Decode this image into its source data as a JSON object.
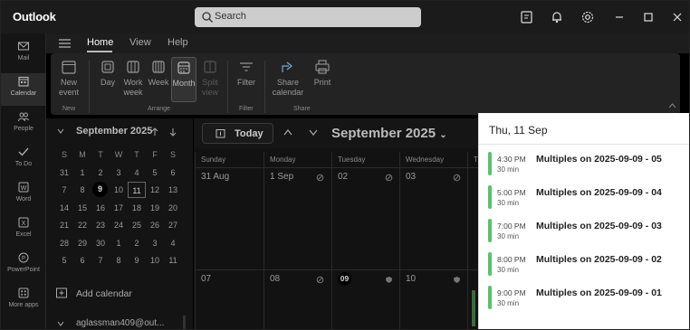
{
  "titlebar": {
    "app_title": "Outlook",
    "search_placeholder": "Search"
  },
  "rail": [
    {
      "label": "Mail",
      "icon": "mail-icon"
    },
    {
      "label": "Calendar",
      "icon": "calendar-icon"
    },
    {
      "label": "People",
      "icon": "people-icon"
    },
    {
      "label": "To Do",
      "icon": "todo-icon"
    },
    {
      "label": "Word",
      "icon": "word-icon"
    },
    {
      "label": "Excel",
      "icon": "excel-icon"
    },
    {
      "label": "PowerPoint",
      "icon": "powerpoint-icon"
    },
    {
      "label": "More apps",
      "icon": "more-apps-icon"
    }
  ],
  "ribbon": {
    "tabs": [
      "Home",
      "View",
      "Help"
    ],
    "new_event": "New event",
    "new_group": "New",
    "views": [
      "Day",
      "Work week",
      "Week",
      "Month",
      "Split view"
    ],
    "arrange_group": "Arrange",
    "filter": "Filter",
    "filter_group": "Filter",
    "share_calendar": "Share calendar",
    "print": "Print",
    "share_group": "Share"
  },
  "mini_calendar": {
    "month": "September 2025",
    "weekdays": [
      "S",
      "M",
      "T",
      "W",
      "T",
      "F",
      "S"
    ],
    "weeks": [
      [
        "31",
        "1",
        "2",
        "3",
        "4",
        "5",
        "6"
      ],
      [
        "7",
        "8",
        "9",
        "10",
        "11",
        "12",
        "13"
      ],
      [
        "14",
        "15",
        "16",
        "17",
        "18",
        "19",
        "20"
      ],
      [
        "21",
        "22",
        "23",
        "24",
        "25",
        "26",
        "27"
      ],
      [
        "28",
        "29",
        "30",
        "1",
        "2",
        "3",
        "4"
      ],
      [
        "5",
        "6",
        "7",
        "8",
        "9",
        "10",
        "11"
      ]
    ],
    "today": "9",
    "selected": "11"
  },
  "side": {
    "add_calendar": "Add calendar",
    "account": "aglassman409@out..."
  },
  "calendar": {
    "today_button": "Today",
    "title": "September 2025",
    "day_headers": [
      "Sunday",
      "Monday",
      "Tuesday",
      "Wednesday",
      "T"
    ],
    "week1": [
      "31 Aug",
      "1 Sep",
      "02",
      "03",
      ""
    ],
    "week2": [
      "07",
      "08",
      "09",
      "10",
      ""
    ]
  },
  "panel": {
    "date": "Thu, 11 Sep",
    "events": [
      {
        "time": "4:30 PM",
        "duration": "30 min",
        "title": "Multiples on 2025-09-09 - 05"
      },
      {
        "time": "5:00 PM",
        "duration": "30 min",
        "title": "Multiples on 2025-09-09 - 04"
      },
      {
        "time": "7:00 PM",
        "duration": "30 min",
        "title": "Multiples on 2025-09-09 - 03"
      },
      {
        "time": "8:00 PM",
        "duration": "30 min",
        "title": "Multiples on 2025-09-09 - 02"
      },
      {
        "time": "9:00 PM",
        "duration": "30 min",
        "title": "Multiples on 2025-09-09 - 01"
      }
    ],
    "event_color": "#5cc06b"
  }
}
